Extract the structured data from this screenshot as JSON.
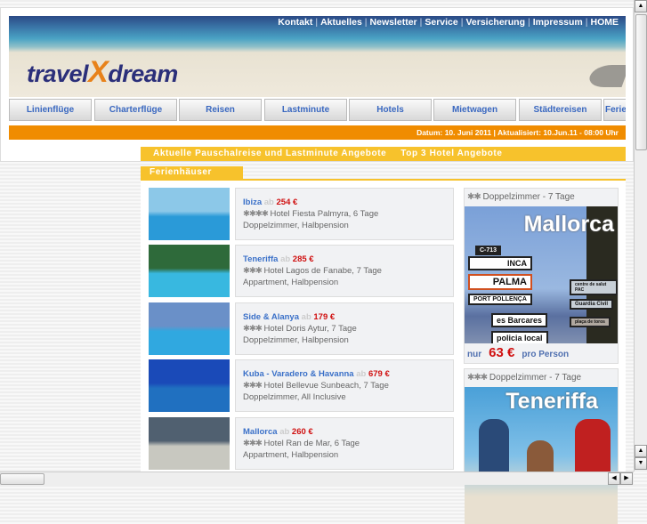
{
  "top_links": [
    "Kontakt",
    "Aktuelles",
    "Newsletter",
    "Service",
    "Versicherung",
    "Impressum",
    "HOME"
  ],
  "logo": {
    "part1": "travel",
    "x": "X",
    "part2": "dream"
  },
  "nav": [
    "Linienflüge",
    "Charterflüge",
    "Reisen",
    "Lastminute",
    "Hotels",
    "Mietwagen",
    "Städtereisen",
    "Ferienhäuser"
  ],
  "date_bar": "Datum: 10. Juni 2011 | Aktualisiert: 10.Jun.11 - 08:00 Uhr",
  "section_tabs": [
    "Aktuelle Pauschalreise und Lastminute Angebote",
    "Top 3 Hotel Angebote"
  ],
  "ferien_tab": "Ferienhäuser",
  "ab_label": "ab",
  "items": [
    {
      "name": "Ibiza",
      "price": "254 €",
      "stars": "✱✱✱✱",
      "hotel": "Hotel Fiesta Palmyra, 6 Tage",
      "details": "Doppelzimmer, Halbpension",
      "colors": [
        "#8cc8e8",
        "#2a9ad8"
      ]
    },
    {
      "name": "Teneriffa",
      "price": "285 €",
      "stars": "✱✱✱",
      "hotel": "Hotel Lagos de Fanabe, 7 Tage",
      "details": "Appartment, Halbpension",
      "colors": [
        "#2e6a3a",
        "#38b8e0"
      ]
    },
    {
      "name": "Side & Alanya",
      "price": "179 €",
      "stars": "✱✱✱",
      "hotel": "Hotel Doris Aytur, 7 Tage",
      "details": "Doppelzimmer, Halbpension",
      "colors": [
        "#6a90c8",
        "#30a8e0"
      ]
    },
    {
      "name": "Kuba - Varadero & Havanna",
      "price": "679 €",
      "stars": "✱✱✱",
      "hotel": "Hotel Bellevue Sunbeach, 7 Tage",
      "details": "Doppelzimmer, All Inclusive",
      "colors": [
        "#1a4ab8",
        "#2070c0"
      ]
    },
    {
      "name": "Mallorca",
      "price": "260 €",
      "stars": "✱✱✱",
      "hotel": "Hotel Ran de Mar, 6 Tage",
      "details": "Appartment, Halbpension",
      "colors": [
        "#506070",
        "#c8c8c0"
      ]
    }
  ],
  "offers": [
    {
      "stars": "✱✱",
      "label": "Doppelzimmer - 7 Tage",
      "title": "Mallorca",
      "signs": [
        "C-713",
        "INCA",
        "PALMA",
        "PORT POLLENÇA",
        "es Barcares",
        "policia local",
        "centre de salut PAC",
        "Guardia Civil",
        "plaça de toros"
      ],
      "prefix": "nur",
      "price": "63 €",
      "suffix": "pro Person"
    },
    {
      "stars": "✱✱✱",
      "label": "Doppelzimmer - 7 Tage",
      "title": "Teneriffa"
    }
  ]
}
